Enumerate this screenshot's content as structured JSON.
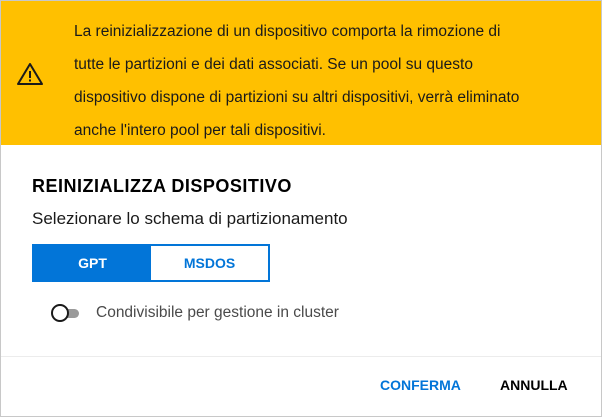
{
  "warning": {
    "icon": "warning-triangle-icon",
    "lines": [
      "La reinizializzazione di un dispositivo comporta la rimozione di",
      "tutte le partizioni e dei dati associati. Se un pool su questo",
      "dispositivo dispone di partizioni su altri dispositivi, verrà eliminato",
      "anche l'intero pool per tali dispositivi."
    ],
    "background_color": "#ffc000"
  },
  "dialog": {
    "title": "REINIZIALIZZA DISPOSITIVO",
    "partition_label": "Selezionare lo schema di partizionamento",
    "partition_options": [
      {
        "label": "GPT",
        "selected": true
      },
      {
        "label": "MSDOS",
        "selected": false
      }
    ],
    "cluster_toggle": {
      "label": "Condivisibile per gestione in cluster",
      "checked": false
    },
    "accent_color": "#0275d8"
  },
  "actions": {
    "confirm_label": "CONFERMA",
    "cancel_label": "ANNULLA"
  }
}
